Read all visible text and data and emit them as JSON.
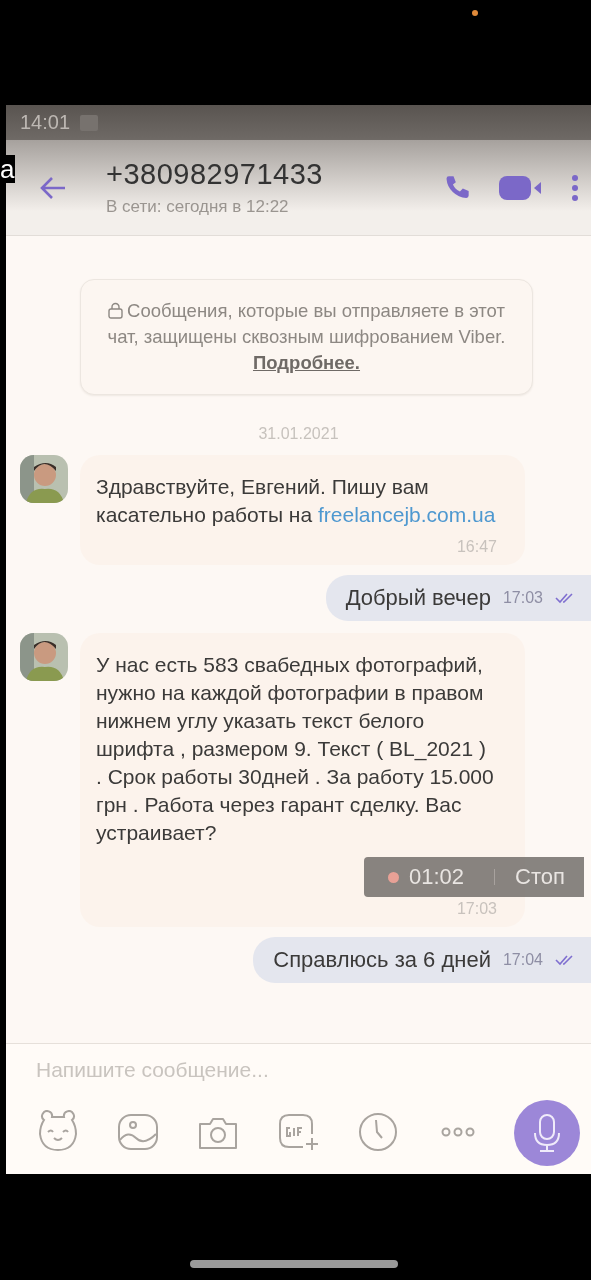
{
  "status_bar": {
    "time": "14:01"
  },
  "edge_text": "a",
  "header": {
    "title": "+380982971433",
    "subtitle": "В сети: сегодня в 12:22"
  },
  "notice": {
    "text": "Сообщения, которые вы отправляете в этот чат, защищены сквозным шифрованием Viber.",
    "link": "Подробнее."
  },
  "date": "31.01.2021",
  "messages": [
    {
      "kind": "incoming",
      "text": "Здравствуйте,  Евгений. Пишу вам касательно работы на",
      "link": "freelancejb.com.ua",
      "time": "16:47"
    },
    {
      "kind": "outgoing",
      "text": "Добрый вечер",
      "time": "17:03"
    },
    {
      "kind": "incoming",
      "text": "У нас есть 583 свабедных фотографий, нужно на каждой фотографии в правом нижнем углу указать текст белого шрифта , размером 9.  Текст ( BL_2021 ) .  Срок работы 30дней .   За работу 15.000 грн .  Работа через гарант сделку.  Вас устраивает?",
      "time": "17:03"
    },
    {
      "kind": "outgoing",
      "text": "Справлюсь за 6 дней",
      "time": "17:04"
    }
  ],
  "recording": {
    "time": "01:02",
    "stop": "Стоп"
  },
  "composer": {
    "placeholder": "Напишите сообщение..."
  }
}
